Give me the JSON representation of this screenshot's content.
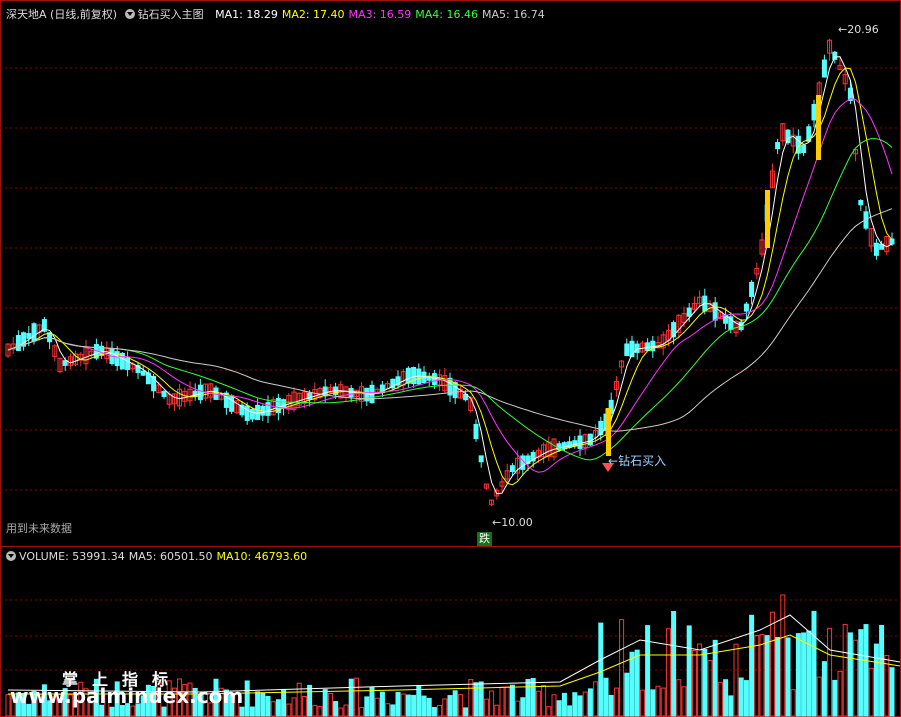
{
  "main_header": {
    "title": "深天地A (日线,前复权)",
    "indicator": "钻石买入主图",
    "ma": [
      {
        "label": "MA1: 18.29",
        "color": "#ffffff"
      },
      {
        "label": "MA2: 17.40",
        "color": "#ffff00"
      },
      {
        "label": "MA3: 16.59",
        "color": "#ff33ff"
      },
      {
        "label": "MA4: 16.46",
        "color": "#33ff33"
      },
      {
        "label": "MA5: 16.74",
        "color": "#cccccc"
      }
    ]
  },
  "volume_header": {
    "items": [
      {
        "label": "VOLUME: 53991.34",
        "color": "#dddddd"
      },
      {
        "label": "MA5: 60501.50",
        "color": "#dddddd"
      },
      {
        "label": "MA10: 46793.60",
        "color": "#ffff00"
      }
    ]
  },
  "annotations": {
    "future_note": "用到未来数据",
    "low": "10.00",
    "high": "20.96",
    "fall_badge": "跌",
    "buy_signal": "钻石买入"
  },
  "watermark": {
    "cn": "掌上指标",
    "url": "www.palmindex.com"
  },
  "colors": {
    "up": "#ff3333",
    "down": "#54ffff",
    "signal": "#ffcc00",
    "grid": "#8b0000",
    "border": "#a01010"
  }
}
